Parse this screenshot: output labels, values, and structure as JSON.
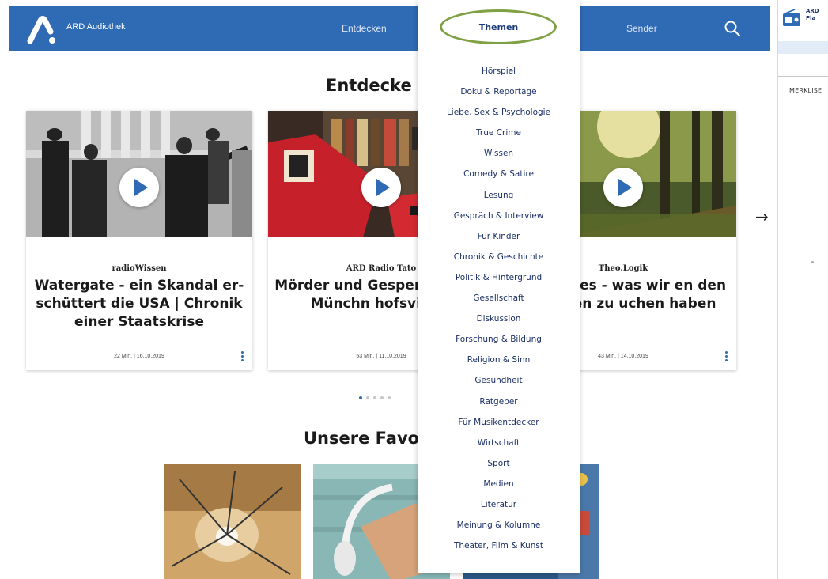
{
  "header": {
    "brand": "ARD Audiothek",
    "nav": {
      "entdecken": "Entdecken",
      "themen": "Themen",
      "sender": "Sender"
    },
    "search_icon": "search-icon",
    "color": "#2f6ab5"
  },
  "side_panel": {
    "label_line1": "ARD",
    "label_line2": "Pla",
    "merkliste": "MERKLISE"
  },
  "main": {
    "section_discover": "Entdecke",
    "section_favorites": "Unsere Favor",
    "cards": [
      {
        "source": "radioWissen",
        "title": "Watergate - ein Skandal er-schüttert die USA | Chronik einer Staatskrise",
        "meta": "22 Min. | 16.10.2019"
      },
      {
        "source": "ARD Radio Tato",
        "title": "Mörder und Gesper Mord im Münchn hofsvierte",
        "meta": "53 Min. | 11.10.2019"
      },
      {
        "source": "Theo.Logik",
        "title": "es Waldes - was wir en den Bäumen zu uchen haben",
        "meta": "43 Min. | 14.10.2019"
      }
    ],
    "carousel": {
      "pages": 5,
      "active": 0
    }
  },
  "dropdown": {
    "title": "Themen",
    "topics": [
      "Hörspiel",
      "Doku & Reportage",
      "Liebe, Sex & Psychologie",
      "True Crime",
      "Wissen",
      "Comedy & Satire",
      "Lesung",
      "Gespräch & Interview",
      "Für Kinder",
      "Chronik & Geschichte",
      "Politik & Hintergrund",
      "Gesellschaft",
      "Diskussion",
      "Forschung & Bildung",
      "Religion & Sinn",
      "Gesundheit",
      "Ratgeber",
      "Für Musikentdecker",
      "Wirtschaft",
      "Sport",
      "Medien",
      "Literatur",
      "Meinung & Kolumne",
      "Theater, Film & Kunst"
    ],
    "highlight_color": "#7fa043"
  }
}
